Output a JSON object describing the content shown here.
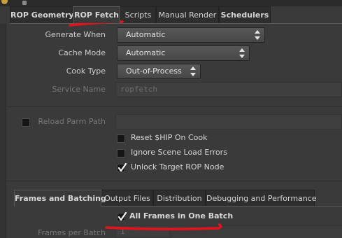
{
  "top_tabs": [
    "ROP Geometry",
    "ROP Fetch",
    "Scripts",
    "Manual Render",
    "Schedulers"
  ],
  "params": {
    "generate_when": {
      "label": "Generate When",
      "value": "Automatic"
    },
    "cache_mode": {
      "label": "Cache Mode",
      "value": "Automatic"
    },
    "cook_type": {
      "label": "Cook Type",
      "value": "Out-of-Process"
    },
    "service_name": {
      "label": "Service Name",
      "value": "ropfetch"
    },
    "reload_parm_path": {
      "label": "Reload Parm Path",
      "value": ""
    }
  },
  "toggles": {
    "reset_hip": {
      "label": "Reset $HIP On Cook",
      "checked": false
    },
    "ignore_scene_errors": {
      "label": "Ignore Scene Load Errors",
      "checked": false
    },
    "unlock_target": {
      "label": "Unlock Target ROP Node",
      "checked": true
    }
  },
  "bottom_tabs": [
    "Frames and Batching",
    "Output Files",
    "Distribution",
    "Debugging and Performance"
  ],
  "batching": {
    "all_frames_label": "All Frames in One Batch",
    "all_frames_checked": true,
    "frames_per_batch_label": "Frames per Batch",
    "frames_per_batch_value": "1"
  },
  "colors": {
    "annotation_red": "#e8111b",
    "panel_bg": "#3a3a3a"
  }
}
